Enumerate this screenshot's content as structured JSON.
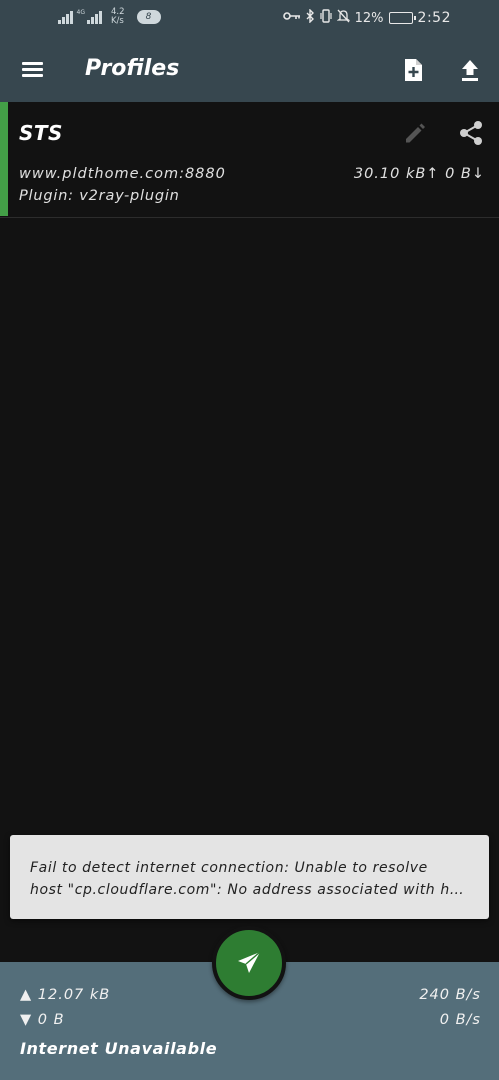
{
  "status_bar": {
    "sim_label": "4G",
    "net_speed_value": "4.2",
    "net_speed_unit": "K/s",
    "notification_count": "8",
    "battery_percent": "12%",
    "battery_level": 0.12,
    "time": "2:52",
    "icons": [
      "key-icon",
      "bluetooth-icon",
      "vibrate-icon",
      "mute-icon",
      "battery-icon"
    ]
  },
  "app_bar": {
    "title": "Profiles",
    "menu_icon": "menu-icon",
    "actions": [
      "new-profile-icon",
      "upload-icon"
    ]
  },
  "profiles": [
    {
      "name": "STS",
      "host": "www.pldthome.com:8880",
      "traffic": "30.10 kB↑ 0 B↓",
      "plugin": "Plugin: v2ray-plugin",
      "selected": true,
      "accent_color": "#43a047"
    }
  ],
  "snackbar": {
    "line1": "Fail to detect internet connection: Unable to resolve",
    "line2": "host \"cp.cloudflare.com\": No address associated with h…"
  },
  "stats": {
    "tx_total": "▲ 12.07 kB",
    "rx_total": "▼ 0 B",
    "tx_rate": "240 B/s",
    "rx_rate": "0 B/s",
    "connection_status": "Internet Unavailable"
  },
  "colors": {
    "toolbar": "#37474f",
    "background": "#121212",
    "bottom_bar": "#546e7a",
    "fab": "#2e7d32"
  }
}
